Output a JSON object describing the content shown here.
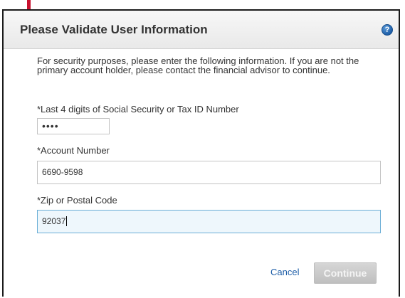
{
  "dialog": {
    "title": "Please Validate User Information",
    "help_icon": "question-circle-icon",
    "help_glyph": "?",
    "intro": "For security purposes, please enter the following information. If you are not the primary account holder, please contact the financial advisor to continue."
  },
  "fields": {
    "ssn": {
      "label": "*Last 4 digits of Social Security or Tax ID Number",
      "value": "••••",
      "masked": true
    },
    "account": {
      "label": "*Account Number",
      "value": "6690-9598"
    },
    "zip": {
      "label": "*Zip or Postal Code",
      "value": "92037",
      "focused": true
    }
  },
  "actions": {
    "cancel_label": "Cancel",
    "continue_label": "Continue",
    "continue_disabled": true
  },
  "colors": {
    "accent_marker": "#c8102e",
    "link": "#1f5fa8",
    "focus_border": "#6aaed6",
    "focus_fill": "#eef7fc",
    "button_disabled": "#c9c9c9"
  }
}
